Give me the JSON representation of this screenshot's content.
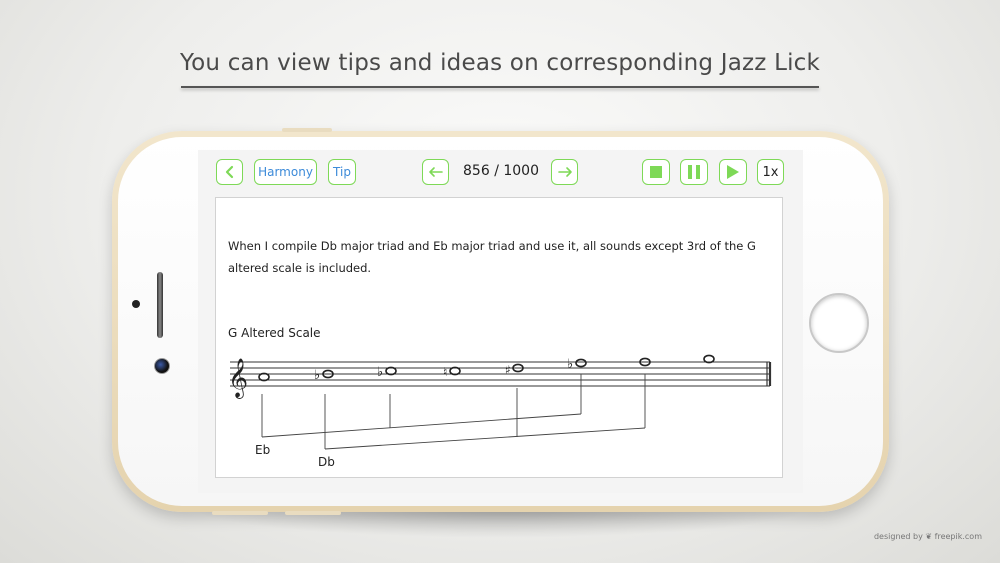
{
  "headline": "You can view tips and ideas on corresponding Jazz Lick",
  "toolbar": {
    "harmony_label": "Harmony",
    "tip_label": "Tip",
    "counter": "856 / 1000",
    "speed_label": "1x",
    "accent_color": "#7ed957",
    "link_color": "#3d8bd9"
  },
  "tip": {
    "body": "When I compile Db major triad and Eb major triad and use it, all sounds except 3rd of the G altered scale is included.",
    "scale_title": "G Altered Scale",
    "notes": [
      "G",
      "A♭",
      "B♭",
      "B♮",
      "C♯",
      "E♭",
      "F",
      "G"
    ],
    "chord_labels": [
      "Eb",
      "Db"
    ]
  },
  "icons": [
    "back-chevron-icon",
    "prev-arrow-icon",
    "next-arrow-icon",
    "stop-icon",
    "pause-icon",
    "play-icon",
    "treble-clef-icon"
  ],
  "watermark": "designed by ❦ freepik.com"
}
